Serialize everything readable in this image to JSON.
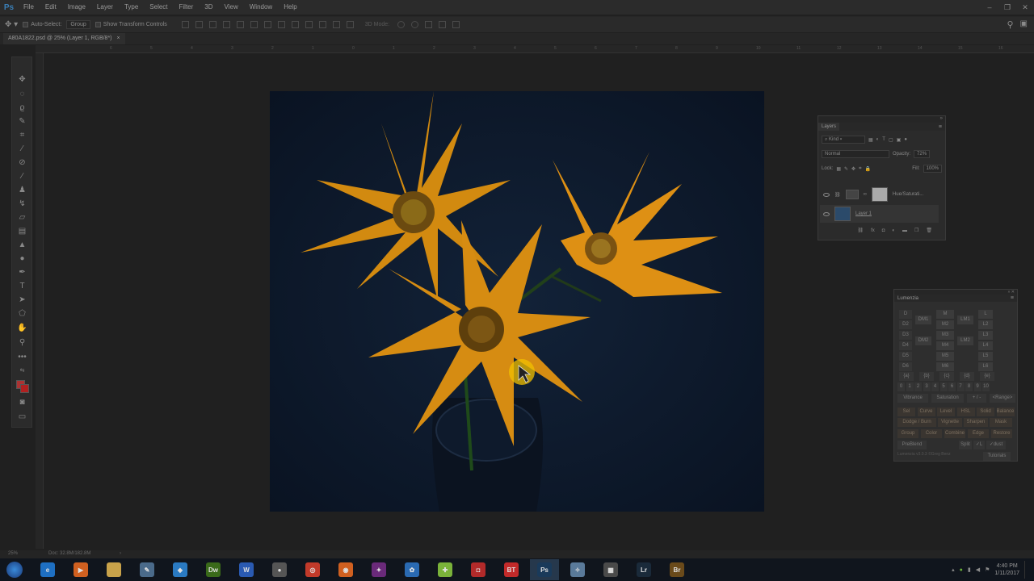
{
  "app": {
    "logo": "Ps"
  },
  "menu": [
    "File",
    "Edit",
    "Image",
    "Layer",
    "Type",
    "Select",
    "Filter",
    "3D",
    "View",
    "Window",
    "Help"
  ],
  "window_controls": [
    "–",
    "❐",
    "✕"
  ],
  "options": {
    "auto_select_label": "Auto-Select:",
    "auto_select_value": "Group",
    "transform_label": "Show Transform Controls",
    "mode_label": "3D Mode:"
  },
  "document": {
    "tab_title": "A80A1822.psd @ 25% (Layer 1, RGB/8*)",
    "close": "×"
  },
  "ruler_top_ticks": [
    "6",
    "5",
    "4",
    "3",
    "2",
    "1",
    "0",
    "1",
    "2",
    "3",
    "4",
    "5",
    "6",
    "7",
    "8",
    "9",
    "10",
    "11",
    "12",
    "13",
    "14",
    "15",
    "16",
    "17",
    "18"
  ],
  "layers_panel": {
    "title": "Layers",
    "kind_filter": "Kind",
    "blend_mode": "Normal",
    "opacity_label": "Opacity:",
    "opacity_value": "72%",
    "lock_label": "Lock:",
    "fill_label": "Fill:",
    "fill_value": "100%",
    "layers": [
      {
        "name": "Hue/Saturati..."
      },
      {
        "name": "Layer 1"
      }
    ]
  },
  "lumenzia": {
    "title": "Lumenzia",
    "col1": [
      "D",
      "D2",
      "D3",
      "D4",
      "D5",
      "D6"
    ],
    "col2": [
      "",
      "DM1",
      "",
      "DM2",
      "",
      ""
    ],
    "col3": [
      "M",
      "M2",
      "M3",
      "M4",
      "M5",
      "M6"
    ],
    "col4": [
      "",
      "LM1",
      "",
      "LM2",
      "",
      ""
    ],
    "col5": [
      "L",
      "L2",
      "L3",
      "L4",
      "L5",
      "L6"
    ],
    "zone_row": [
      "{a}",
      "{b}",
      "{c}",
      "{d}",
      "{e}"
    ],
    "num_row": [
      "0",
      "1",
      "2",
      "3",
      "4",
      "5",
      "6",
      "7",
      "8",
      "9",
      "10"
    ],
    "vib_row": [
      "Vibrance",
      "Saturation",
      "+ / -",
      "<Range>"
    ],
    "row1": [
      "Sel",
      "Curve",
      "Level",
      "HSL",
      "Solid",
      "Balance"
    ],
    "row2": [
      "Dodge / Burn",
      "Vignette",
      "Sharpen",
      "Mask"
    ],
    "row3": [
      "Group",
      "Color",
      "Combine",
      "Edge",
      "Restore"
    ],
    "row4": [
      "PreBlend",
      "Split",
      "✓L",
      "✓dust"
    ],
    "footer": "Lumenzia v3.0.3 ©Greg Benz",
    "tutorials": "Tutorials"
  },
  "status": {
    "zoom": "25%",
    "doc": "Doc: 32.8M/182.8M"
  },
  "taskbar": {
    "apps": [
      {
        "name": "ie",
        "label": "e",
        "color": "#1e6fc2"
      },
      {
        "name": "media",
        "label": "▶",
        "color": "#d06020"
      },
      {
        "name": "explorer",
        "label": "",
        "color": "#c8a24a"
      },
      {
        "name": "tool1",
        "label": "✎",
        "color": "#4a6a8a"
      },
      {
        "name": "tool2",
        "label": "◆",
        "color": "#2a7ac2"
      },
      {
        "name": "dreamweaver",
        "label": "Dw",
        "color": "#3a6a1a"
      },
      {
        "name": "word",
        "label": "W",
        "color": "#2a5ab2"
      },
      {
        "name": "app8",
        "label": "●",
        "color": "#555"
      },
      {
        "name": "chrome",
        "label": "◎",
        "color": "#c23a2a"
      },
      {
        "name": "firefox",
        "label": "◉",
        "color": "#d06020"
      },
      {
        "name": "app11",
        "label": "✦",
        "color": "#6a2a7a"
      },
      {
        "name": "app12",
        "label": "✿",
        "color": "#2a6ab2"
      },
      {
        "name": "app13",
        "label": "✚",
        "color": "#7ab23a"
      },
      {
        "name": "app14",
        "label": "◘",
        "color": "#b22a2a"
      },
      {
        "name": "app15",
        "label": "BT",
        "color": "#c22a2a"
      },
      {
        "name": "photoshop",
        "label": "Ps",
        "color": "#1a3a5a"
      },
      {
        "name": "app17",
        "label": "✧",
        "color": "#5a7a9a"
      },
      {
        "name": "app18",
        "label": "▦",
        "color": "#4a4a4a"
      },
      {
        "name": "lightroom",
        "label": "Lr",
        "color": "#1a2a3a"
      },
      {
        "name": "bridge",
        "label": "Br",
        "color": "#6a4a1a"
      }
    ],
    "time": "4:40 PM",
    "date": "1/11/2017"
  }
}
